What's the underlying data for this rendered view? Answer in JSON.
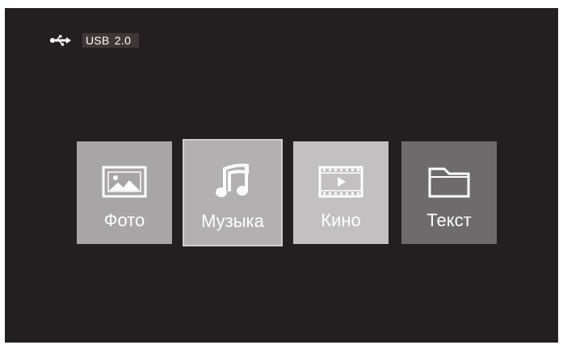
{
  "status": {
    "device_icon": "usb-icon",
    "device_label": "USB  2.0"
  },
  "menu": {
    "items": [
      {
        "label": "Фото",
        "icon": "photo-icon"
      },
      {
        "label": "Музыка",
        "icon": "music-note-icon",
        "selected": true
      },
      {
        "label": "Кино",
        "icon": "film-icon"
      },
      {
        "label": "Текст",
        "icon": "folder-icon"
      }
    ]
  },
  "colors": {
    "screen_background": "#231f20",
    "usb_label_background": "#3d3833",
    "tile_photo": "#a7a5a6",
    "tile_music": "#b2b0b1",
    "tile_movie": "#c2c0c1",
    "tile_text": "#6d6b6c"
  }
}
